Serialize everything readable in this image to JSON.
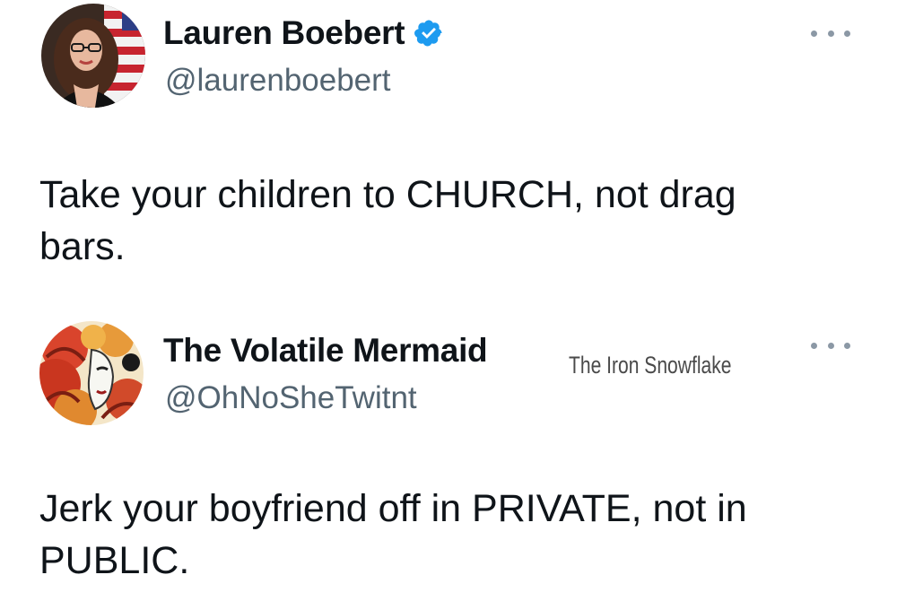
{
  "tweets": [
    {
      "display_name": "Lauren Boebert",
      "handle": "@laurenboebert",
      "verified": true,
      "text": "Take your children to CHURCH, not drag bars.",
      "avatar_icon": "portrait-with-flag-avatar"
    },
    {
      "display_name": "The Volatile Mermaid",
      "handle": "@OhNoSheTwitnt",
      "verified": false,
      "text": "Jerk your boyfriend off in PRIVATE, not in PUBLIC.",
      "avatar_icon": "red-hair-mask-avatar"
    }
  ],
  "watermark": "The Iron Snowflake",
  "colors": {
    "text": "#0f1419",
    "secondary": "#536471",
    "verified": "#1d9bf0",
    "more_dots": "#8b98a5"
  }
}
